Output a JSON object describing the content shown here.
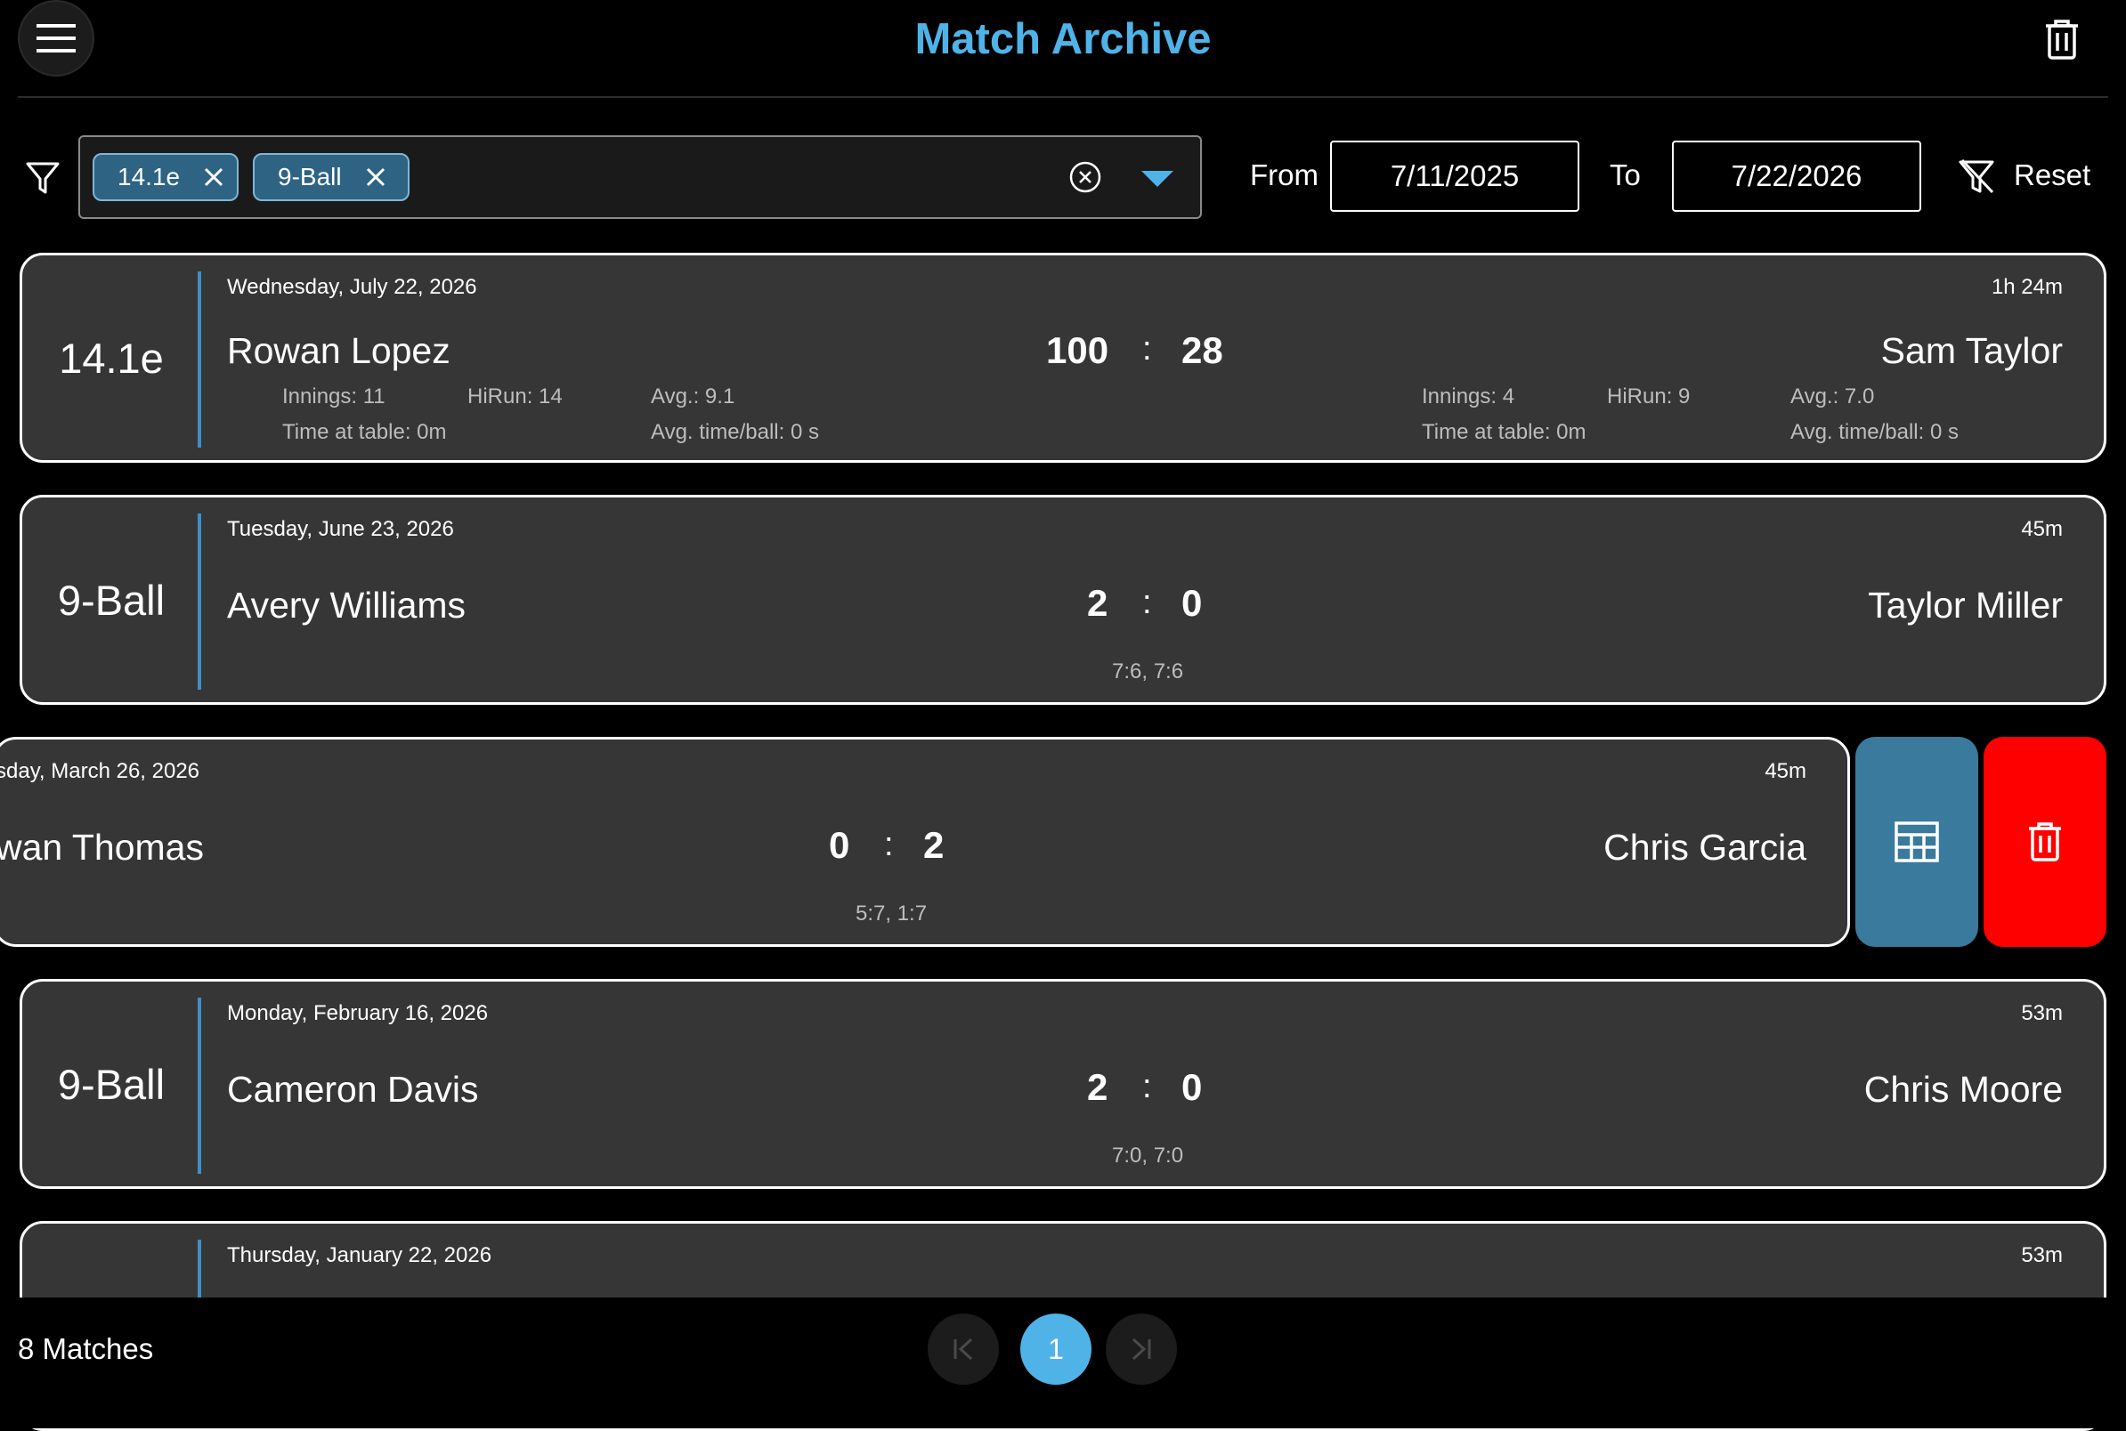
{
  "header": {
    "title": "Match Archive",
    "menu_icon": "hamburger-icon",
    "delete_all_icon": "trash-icon"
  },
  "filters": {
    "chips": [
      {
        "label": "14.1e"
      },
      {
        "label": "9-Ball"
      }
    ],
    "from_label": "From",
    "from_value": "7/11/2025",
    "to_label": "To",
    "to_value": "7/22/2026",
    "reset_label": "Reset"
  },
  "matches": [
    {
      "game": "14.1e",
      "date": "Wednesday, July 22, 2026",
      "duration": "1h 24m",
      "p1": "Rowan Lopez",
      "p2": "Sam Taylor",
      "s1": "100",
      "s2": "28",
      "p1_innings": "Innings: 11",
      "p1_hirun": "HiRun: 14",
      "p1_avg": "Avg.: 9.1",
      "p1_time": "Time at table: 0m",
      "p1_avgball": "Avg. time/ball: 0 s",
      "p2_innings": "Innings: 4",
      "p2_hirun": "HiRun: 9",
      "p2_avg": "Avg.: 7.0",
      "p2_time": "Time at table: 0m",
      "p2_avgball": "Avg. time/ball: 0 s"
    },
    {
      "game": "9-Ball",
      "date": "Tuesday, June 23, 2026",
      "duration": "45m",
      "p1": "Avery Williams",
      "p2": "Taylor Miller",
      "s1": "2",
      "s2": "0",
      "sets": "7:6, 7:6"
    },
    {
      "date": "sday, March 26, 2026",
      "duration": "45m",
      "p1": "wan Thomas",
      "p2": "Chris Garcia",
      "s1": "0",
      "s2": "2",
      "sets": "5:7, 1:7"
    },
    {
      "game": "9-Ball",
      "date": "Monday, February 16, 2026",
      "duration": "53m",
      "p1": "Cameron Davis",
      "p2": "Chris Moore",
      "s1": "2",
      "s2": "0",
      "sets": "7:0, 7:0"
    },
    {
      "date": "Thursday, January 22, 2026",
      "duration": "53m"
    }
  ],
  "footer": {
    "count": "8 Matches",
    "current_page": "1"
  },
  "colors": {
    "accent": "#4fb3e8",
    "card_bg": "#363636",
    "stats_button": "#3a7a9c",
    "delete_button": "#ff0000"
  }
}
